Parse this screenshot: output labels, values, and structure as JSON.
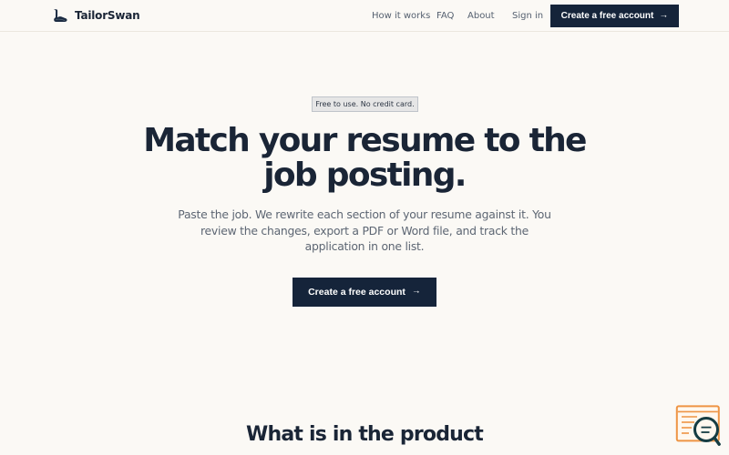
{
  "brand": {
    "name": "TailorSwan",
    "logo_icon": "swan-icon"
  },
  "nav": {
    "items": [
      {
        "label": "How it works"
      },
      {
        "label": "FAQ"
      },
      {
        "label": "About"
      },
      {
        "label": "Sign in"
      }
    ],
    "cta_label": "Create a free account",
    "cta_icon": "arrow-right-icon"
  },
  "hero": {
    "badge": "Free to use. No credit card.",
    "title": "Match your resume to the job posting.",
    "subtitle": "Paste the job. We rewrite each section of your resume against it. You review the changes, export a PDF or Word file, and track the application in one list.",
    "cta_label": "Create a free account",
    "cta_icon": "arrow-right-icon"
  },
  "product": {
    "title": "What is in the product"
  },
  "widget": {
    "icon": "chat-search-icon"
  },
  "colors": {
    "background": "#fbf9f5",
    "primary": "#15243a",
    "text": "#1a2536",
    "muted": "#5d6673",
    "widget_orange": "#ee9444",
    "widget_teal": "#163d43"
  }
}
